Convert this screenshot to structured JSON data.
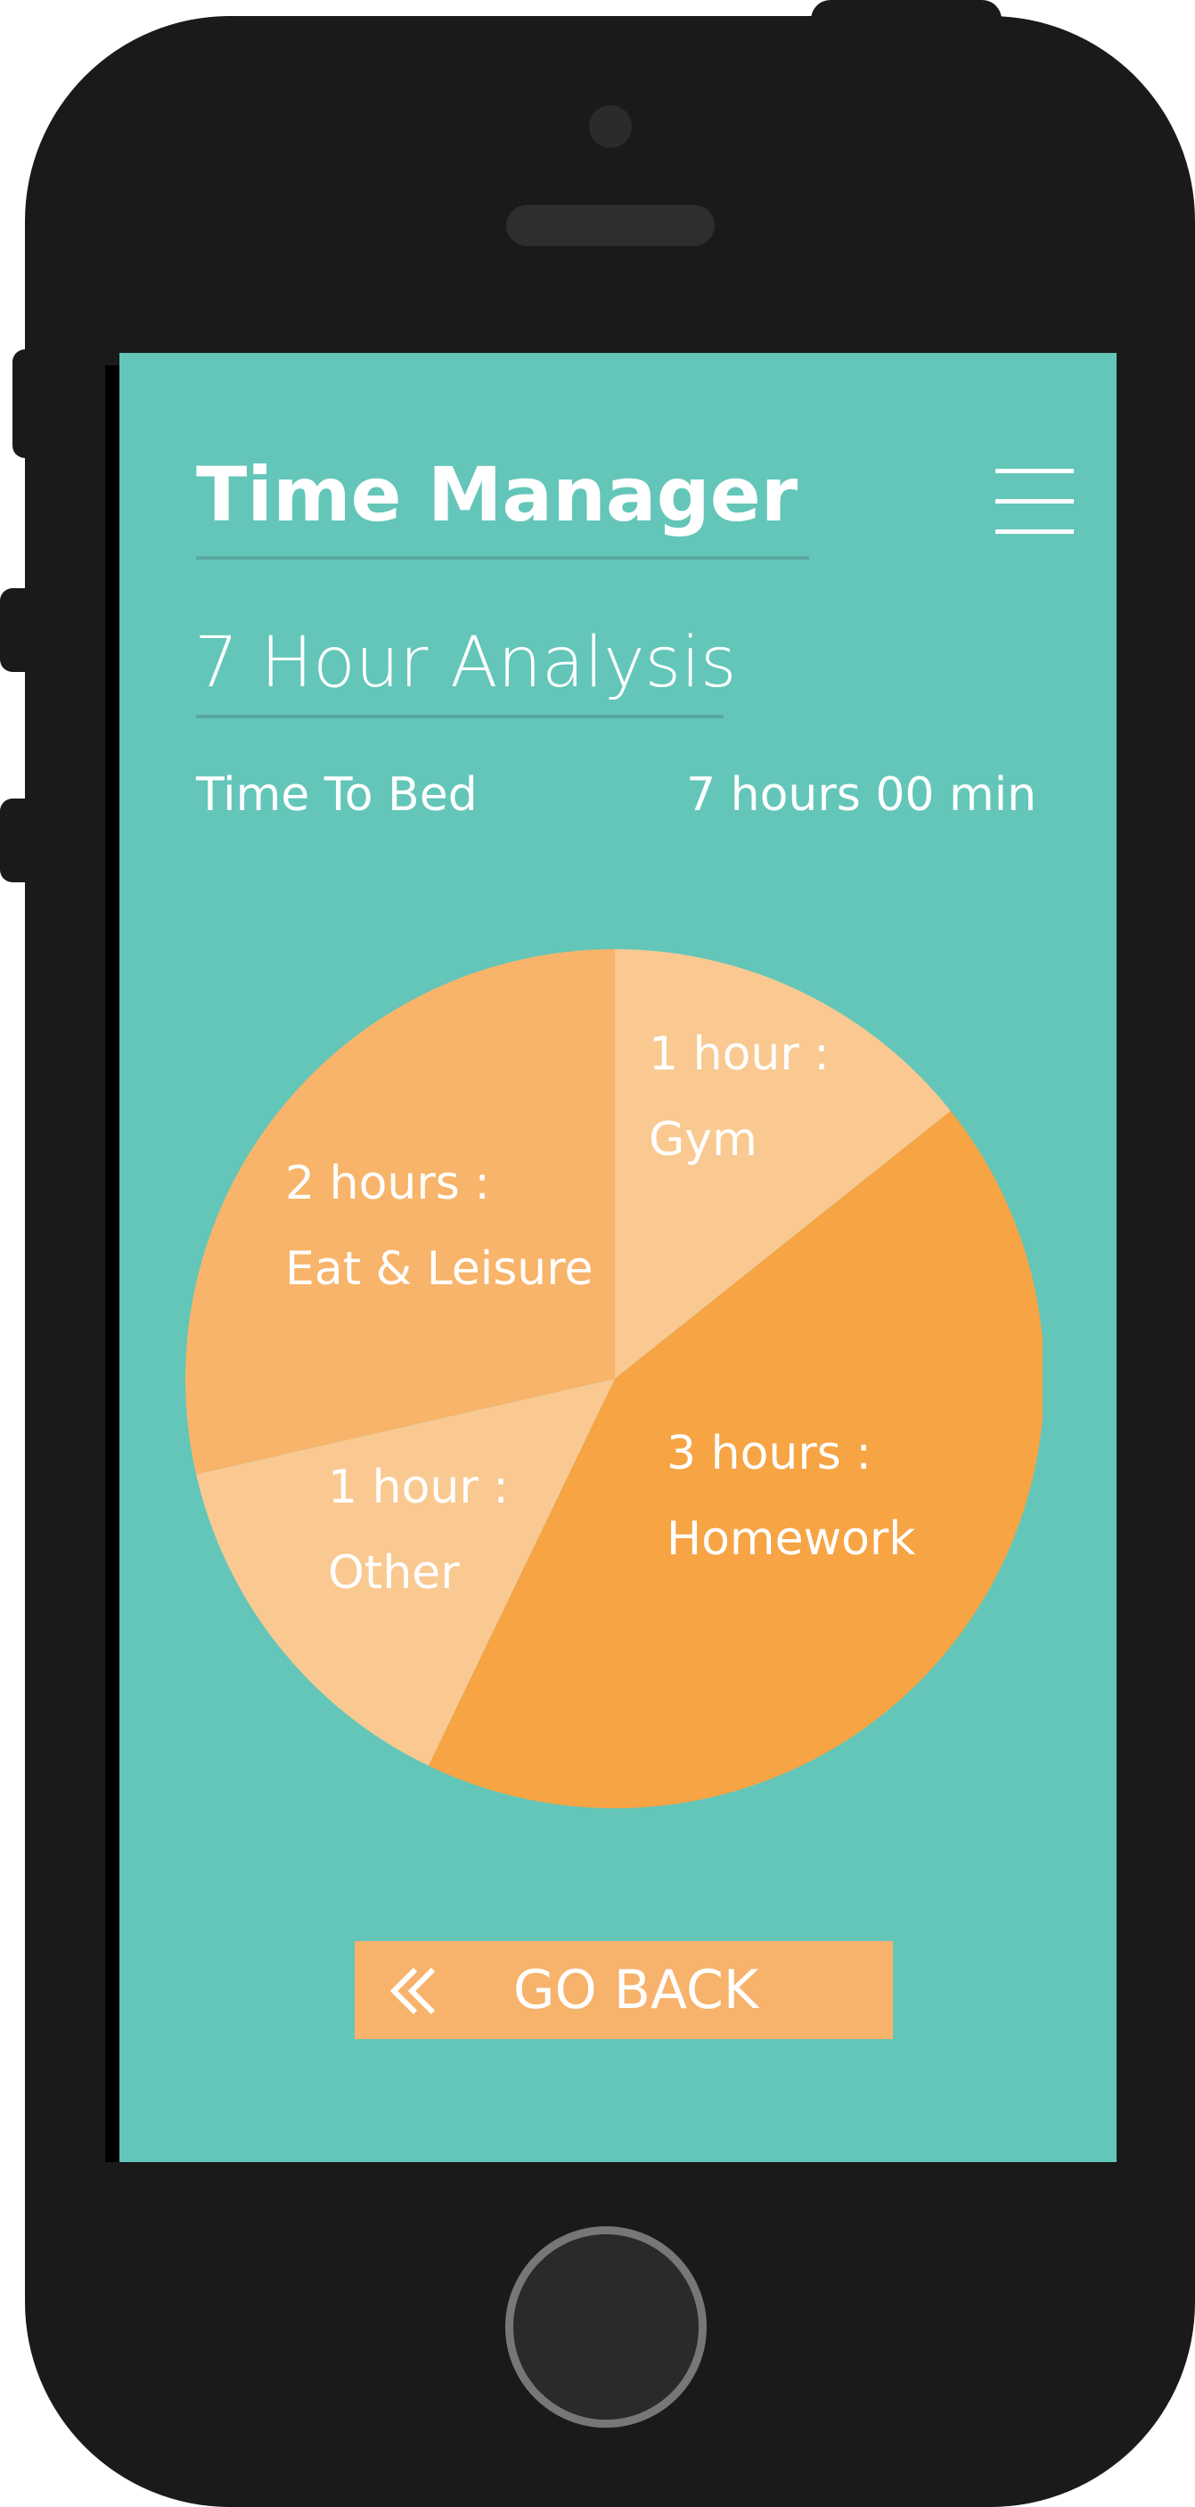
{
  "header": {
    "title": "Time Manager",
    "menu_icon": "hamburger-menu-icon"
  },
  "analysis": {
    "subtitle": "7 Hour Analysis",
    "time_to_bed_label": "Time To Bed",
    "time_to_bed_value": "7 hours 00 min"
  },
  "chart_data": {
    "type": "pie",
    "unit": "hours",
    "slices": [
      {
        "label": "Gym",
        "value": 1,
        "text_top": "1 hour :",
        "text_bottom": "Gym",
        "color": "#f9c991"
      },
      {
        "label": "Homework",
        "value": 3,
        "text_top": "3 hours :",
        "text_bottom": "Homework",
        "color": "#f6a444"
      },
      {
        "label": "Other",
        "value": 1,
        "text_top": "1 hour :",
        "text_bottom": "Other",
        "color": "#f9c991"
      },
      {
        "label": "Eat & Leisure",
        "value": 2,
        "text_top": "2 hours :",
        "text_bottom": "Eat & Leisure",
        "color": "#f7b46a"
      }
    ]
  },
  "go_back": {
    "label": "GO BACK",
    "icon": "double-chevron-left-icon"
  },
  "colors": {
    "screen_background": "#63c6b9",
    "button_background": "#f7b26c",
    "phone_body": "#1a1a1a"
  }
}
